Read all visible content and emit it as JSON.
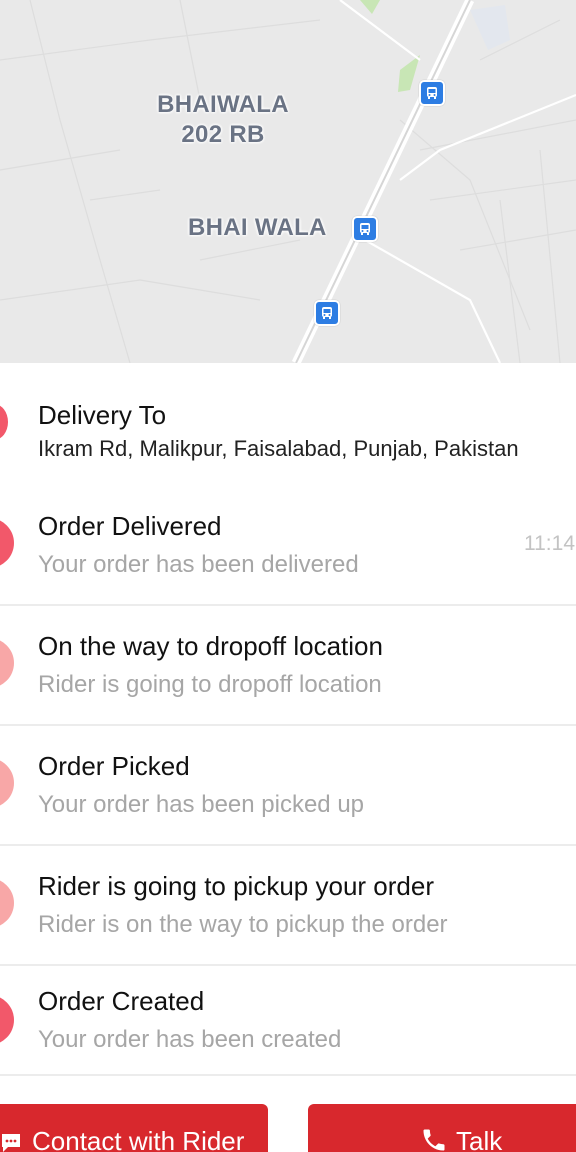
{
  "map": {
    "labels": {
      "village_1_line1": "BHAIWALA",
      "village_1_line2": "202 RB",
      "village_2": "BHAI WALA"
    },
    "bus_stop_icon": "bus-stop-icon",
    "colors": {
      "background": "#e9e9e9",
      "bus_stop": "#2d7de3",
      "label": "#6a7384"
    }
  },
  "delivery": {
    "title": "Delivery To",
    "address": "Ikram Rd, Malikpur, Faisalabad, Punjab, Pakistan"
  },
  "timeline": [
    {
      "title": "Order Delivered",
      "subtitle": "Your order has been delivered",
      "time": "11:14",
      "dot_color": "#f2586a"
    },
    {
      "title": "On the way to dropoff location",
      "subtitle": "Rider is going to dropoff location",
      "dot_color": "#f8a7a7"
    },
    {
      "title": "Order Picked",
      "subtitle": "Your order has been picked up",
      "dot_color": "#f8a7a7"
    },
    {
      "title": "Rider is going to pickup your order",
      "subtitle": "Rider is on the way to pickup the order",
      "dot_color": "#f8a7a7"
    },
    {
      "title": "Order Created",
      "subtitle": "Your order has been created",
      "dot_color": "#f2586a"
    }
  ],
  "actions": {
    "contact_label": "Contact with Rider",
    "contact_icon": "chat-icon",
    "talk_label": "Talk",
    "talk_icon": "phone-icon",
    "button_color": "#d8282d"
  }
}
